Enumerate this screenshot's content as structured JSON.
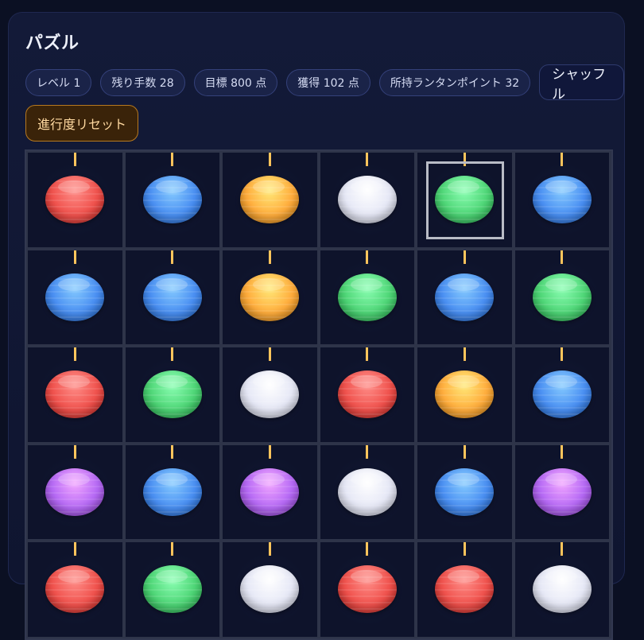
{
  "title": "パズル",
  "stats": {
    "level": "レベル 1",
    "moves_left": "残り手数 28",
    "target": "目標 800 点",
    "earned": "獲得 102 点",
    "lantern_points": "所持ランタンポイント 32"
  },
  "buttons": {
    "shuffle": "シャッフル",
    "reset_progress": "進行度リセット"
  },
  "colors": {
    "red": "#f0524d",
    "blue": "#4a8ff2",
    "orange": "#ffad3d",
    "white": "#e6e8f6",
    "green": "#4fd677",
    "purple": "#b66af5"
  },
  "board": {
    "selected": {
      "row": 0,
      "col": 4
    },
    "rows": [
      [
        "red",
        "blue",
        "orange",
        "white",
        "green",
        "blue"
      ],
      [
        "blue",
        "blue",
        "orange",
        "green",
        "blue",
        "green"
      ],
      [
        "red",
        "green",
        "white",
        "red",
        "orange",
        "blue"
      ],
      [
        "purple",
        "blue",
        "purple",
        "white",
        "blue",
        "purple"
      ],
      [
        "red",
        "green",
        "white",
        "red",
        "red",
        "white"
      ]
    ]
  }
}
